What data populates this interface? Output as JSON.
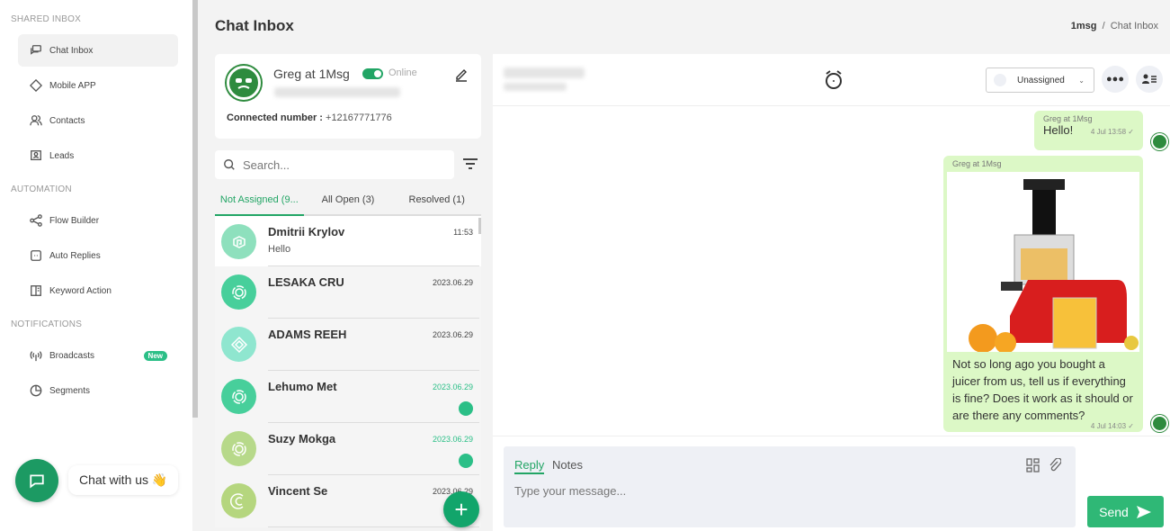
{
  "sidebar": {
    "sections": [
      {
        "title": "SHARED INBOX"
      },
      {
        "title": "AUTOMATION"
      },
      {
        "title": "NOTIFICATIONS"
      }
    ],
    "items": [
      {
        "label": "Chat Inbox",
        "icon": "chat-icon",
        "active": true
      },
      {
        "label": "Mobile APP",
        "icon": "mobile-icon"
      },
      {
        "label": "Contacts",
        "icon": "contacts-icon"
      },
      {
        "label": "Leads",
        "icon": "leads-icon"
      },
      {
        "label": "Flow Builder",
        "icon": "share-icon"
      },
      {
        "label": "Auto Replies",
        "icon": "auto-reply-icon"
      },
      {
        "label": "Keyword Action",
        "icon": "keyword-icon"
      },
      {
        "label": "Broadcasts",
        "icon": "broadcast-icon",
        "badge": "New"
      },
      {
        "label": "Segments",
        "icon": "pie-icon"
      }
    ],
    "chat_with_us": "Chat with us 👋"
  },
  "header": {
    "title": "Chat Inbox",
    "breadcrumb": [
      "1msg",
      "Chat Inbox"
    ]
  },
  "profile": {
    "name": "Greg at 1Msg",
    "status": "Online",
    "connected_label": "Connected number :",
    "connected_number": "+12167771776"
  },
  "search": {
    "placeholder": "Search..."
  },
  "tabs": [
    {
      "label": "Not Assigned (9...",
      "active": true
    },
    {
      "label": "All Open (3)"
    },
    {
      "label": "Resolved (1)"
    }
  ],
  "chats": [
    {
      "name": "Dmitrii Krylov",
      "preview": "Hello",
      "time": "11:53",
      "color": "#8ee0bd",
      "selected": true
    },
    {
      "name": "LESAKA CRU",
      "preview": "",
      "time": "2023.06.29",
      "color": "#47cf9b"
    },
    {
      "name": "ADAMS REEH",
      "preview": "",
      "time": "2023.06.29",
      "color": "#8fe6cf"
    },
    {
      "name": "Lehumo Met",
      "preview": "",
      "time": "2023.06.29",
      "color": "#47cf9b",
      "unread": true
    },
    {
      "name": "Suzy Mokga",
      "preview": "",
      "time": "2023.06.29",
      "color": "#b7d98a",
      "unread": true
    },
    {
      "name": "Vincent Se",
      "preview": "",
      "time": "2023.06.29",
      "color": "#b5d67e"
    }
  ],
  "conversation": {
    "assignee": "Unassigned",
    "messages": [
      {
        "sender": "Greg at 1Msg",
        "text": "Hello!",
        "time": "4 Jul 13:58"
      },
      {
        "sender": "Greg at 1Msg",
        "image": "juicer",
        "text": "Not so long ago you bought a juicer from us, tell us if everything is fine? Does it work as it should or are there any comments?",
        "time": "4 Jul 14:03"
      }
    ]
  },
  "composer": {
    "reply_tab": "Reply",
    "notes_tab": "Notes",
    "placeholder": "Type your message...",
    "send_label": "Send"
  }
}
